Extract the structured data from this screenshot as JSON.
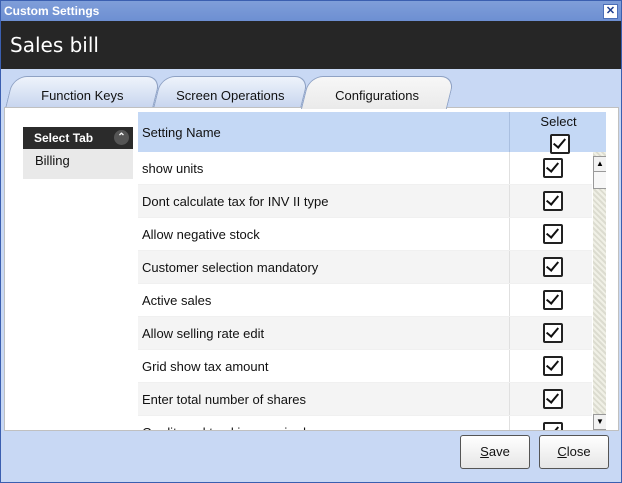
{
  "window": {
    "title": "Custom Settings",
    "close_glyph": "✕"
  },
  "header": {
    "title": "Sales bill"
  },
  "tabs": [
    {
      "label": "Function Keys",
      "active": false
    },
    {
      "label": "Screen Operations",
      "active": false
    },
    {
      "label": "Configurations",
      "active": true
    }
  ],
  "sidebar": {
    "header": "Select Tab",
    "collapse_icon": "double-chevron-up-icon",
    "items": [
      "Billing"
    ]
  },
  "grid": {
    "columns": {
      "name": "Setting Name",
      "select": "Select"
    },
    "rows": [
      {
        "name": "show units",
        "checked": true
      },
      {
        "name": "Dont calculate tax for INV II type",
        "checked": true
      },
      {
        "name": "Allow negative stock",
        "checked": true
      },
      {
        "name": "Customer selection mandatory",
        "checked": true
      },
      {
        "name": "Active sales",
        "checked": true
      },
      {
        "name": "Allow selling rate edit",
        "checked": true
      },
      {
        "name": "Grid show tax amount",
        "checked": true
      },
      {
        "name": "Enter total number of shares",
        "checked": true
      },
      {
        "name": "Credit card tracking required",
        "checked": true
      }
    ]
  },
  "buttons": {
    "save_first": "S",
    "save_rest": "ave",
    "close_first": "C",
    "close_rest": "lose"
  }
}
